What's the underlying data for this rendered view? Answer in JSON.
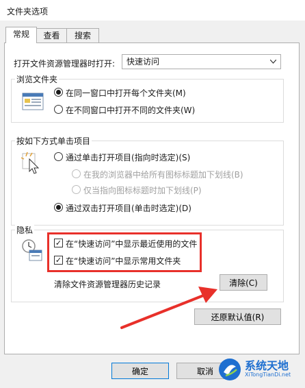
{
  "window": {
    "title": "文件夹选项"
  },
  "tabs": [
    {
      "label": "常规",
      "active": true
    },
    {
      "label": "查看",
      "active": false
    },
    {
      "label": "搜索",
      "active": false
    }
  ],
  "open_explorer": {
    "label": "打开文件资源管理器时打开:",
    "value": "快速访问"
  },
  "browse_folders": {
    "title": "浏览文件夹",
    "options": [
      {
        "label": "在同一窗口中打开每个文件夹(M)",
        "checked": true
      },
      {
        "label": "在不同窗口中打开不同的文件夹(W)",
        "checked": false
      }
    ]
  },
  "click_items": {
    "title": "按如下方式单击项目",
    "single_click": {
      "label": "通过单击打开项目(指向时选定)(S)",
      "checked": false
    },
    "sub_options": [
      {
        "label": "在我的浏览器中给所有图标标题加下划线(B)",
        "enabled": false
      },
      {
        "label": "仅当指向图标标题时加下划线(P)",
        "enabled": false
      }
    ],
    "double_click": {
      "label": "通过双击打开项目(单击时选定)(D)",
      "checked": true
    }
  },
  "privacy": {
    "title": "隐私",
    "checkboxes": [
      {
        "label": "在“快速访问”中显示最近使用的文件",
        "checked": true
      },
      {
        "label": "在“快速访问”中显示常用文件夹",
        "checked": true
      }
    ],
    "clear_history_label": "清除文件资源管理器历史记录",
    "clear_button": "清除(C)"
  },
  "restore_defaults_button": "还原默认值(R)",
  "footer": {
    "ok": "确定",
    "cancel": "取消"
  },
  "watermark": {
    "brand": "系统天地",
    "url": "XiTongTianDi.net"
  },
  "colors": {
    "annotation": "#e8302a",
    "focus": "#0078d7"
  }
}
